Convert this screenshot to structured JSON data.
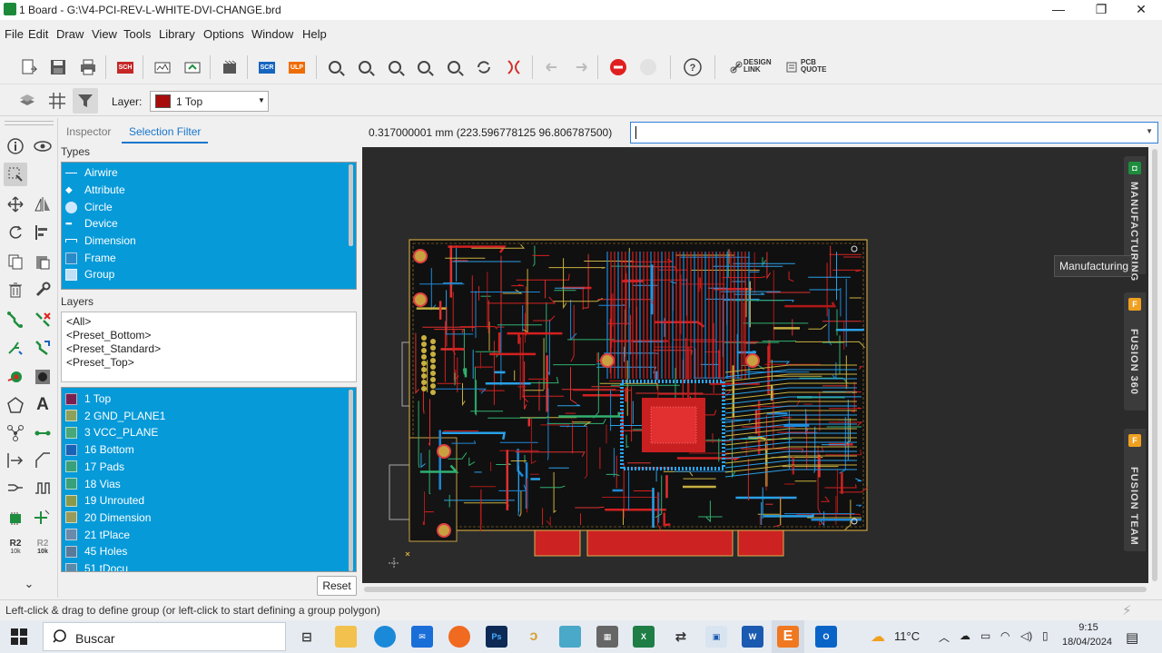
{
  "window": {
    "title": "1 Board - G:\\V4-PCI-REV-L-WHITE-DVI-CHANGE.brd",
    "minimize": "—",
    "maximize": "❐",
    "close": "✕"
  },
  "menu": [
    "File",
    "Edit",
    "Draw",
    "View",
    "Tools",
    "Library",
    "Options",
    "Window",
    "Help"
  ],
  "toolbar": {
    "sch": "SCH",
    "scr": "SCR",
    "ulp": "ULP",
    "help": "?",
    "design_link": "DESIGN\nLINK",
    "pcb_quote": "PCB\nQUOTE"
  },
  "layer_toolbar": {
    "label": "Layer:",
    "value": "1 Top",
    "color": "#a80d0d"
  },
  "palette": {
    "r2_label": "R2",
    "r2_value": "10k"
  },
  "panel": {
    "tabs": [
      "Inspector",
      "Selection Filter"
    ],
    "active_tab": "Selection Filter",
    "types_label": "Types",
    "types": [
      {
        "name": "Airwire"
      },
      {
        "name": "Attribute"
      },
      {
        "name": "Circle"
      },
      {
        "name": "Device"
      },
      {
        "name": "Dimension"
      },
      {
        "name": "Frame"
      },
      {
        "name": "Group"
      }
    ],
    "layers_label": "Layers",
    "presets": [
      "<All>",
      "<Preset_Bottom>",
      "<Preset_Standard>",
      "<Preset_Top>"
    ],
    "layers": [
      {
        "name": "1 Top",
        "color": "#7a2050"
      },
      {
        "name": "2 GND_PLANE1",
        "color": "#8ea15a"
      },
      {
        "name": "3 VCC_PLANE",
        "color": "#4aa878"
      },
      {
        "name": "16 Bottom",
        "color": "#1a62b4"
      },
      {
        "name": "17 Pads",
        "color": "#3aa07a"
      },
      {
        "name": "18 Vias",
        "color": "#3aa07a"
      },
      {
        "name": "19 Unrouted",
        "color": "#8a9a4a"
      },
      {
        "name": "20 Dimension",
        "color": "#9a9a5a"
      },
      {
        "name": "21 tPlace",
        "color": "#6a8aaa"
      },
      {
        "name": "45 Holes",
        "color": "#5a7a9a"
      },
      {
        "name": "51 tDocu",
        "color": "#5a8aaa"
      }
    ],
    "reset": "Reset"
  },
  "coords": "0.317000001 mm (223.596778125 96.806787500)",
  "command_value": "",
  "side_tabs": [
    "MANUFACTURING",
    "FUSION 360",
    "FUSION TEAM"
  ],
  "tooltip": "Manufacturing",
  "status": "Left-click & drag to define group (or left-click to start defining a group polygon)",
  "taskbar": {
    "search": "Buscar",
    "weather": "11°C",
    "time": "9:15",
    "date": "18/04/2024"
  }
}
